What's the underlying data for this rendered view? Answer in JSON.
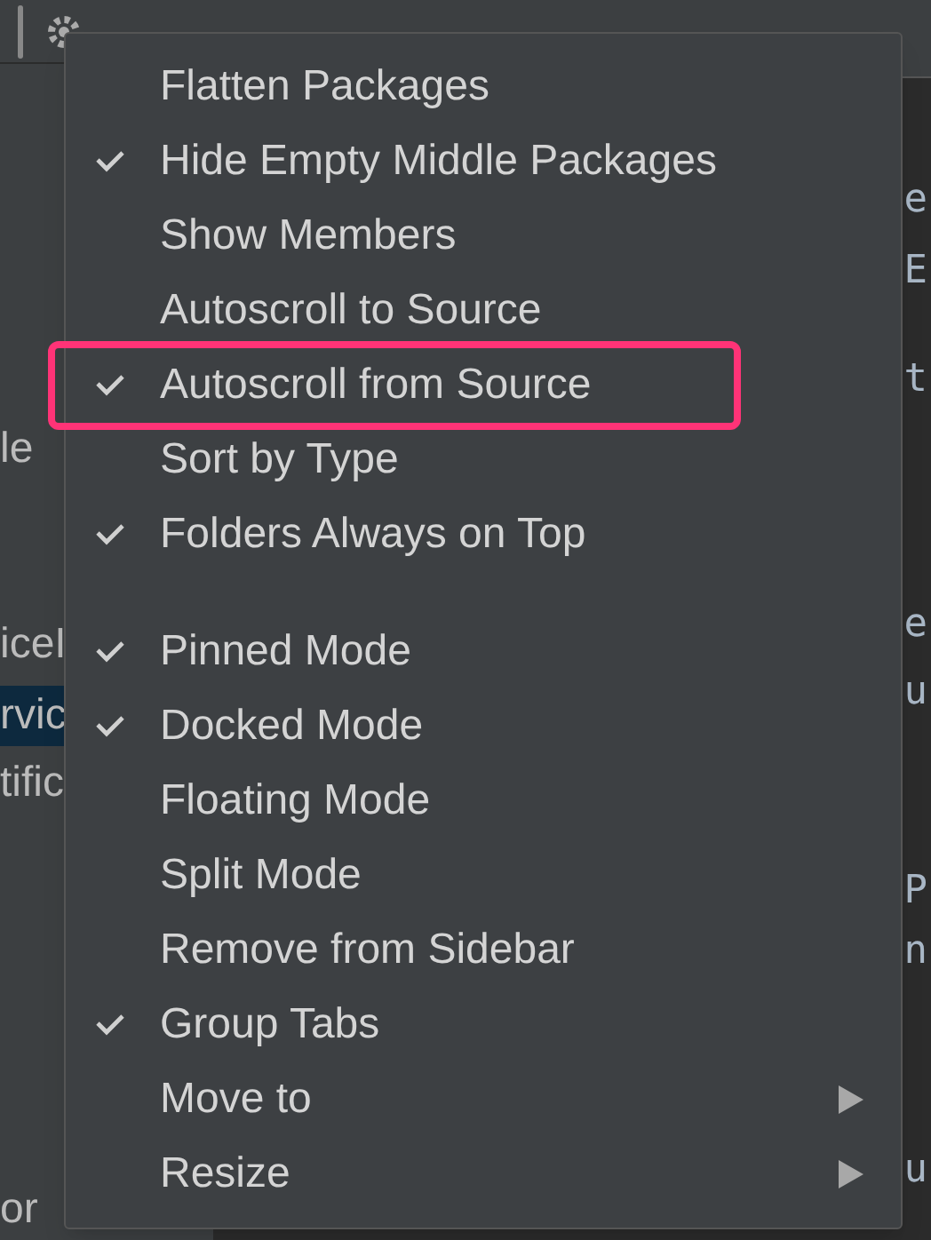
{
  "project_tree": [
    {
      "text": "le",
      "selected": false
    },
    {
      "text": "iceI",
      "selected": false
    },
    {
      "text": "rvic",
      "selected": true
    },
    {
      "text": "tific",
      "selected": false
    },
    {
      "text": "or",
      "selected": false
    }
  ],
  "editor_fragments": [
    "e",
    "E",
    "t",
    "e",
    "u",
    "P",
    "n",
    "u"
  ],
  "menu": {
    "groups": [
      [
        {
          "label": "Flatten Packages",
          "checked": false,
          "submenu": false,
          "highlighted": false
        },
        {
          "label": "Hide Empty Middle Packages",
          "checked": true,
          "submenu": false,
          "highlighted": false
        },
        {
          "label": "Show Members",
          "checked": false,
          "submenu": false,
          "highlighted": false
        },
        {
          "label": "Autoscroll to Source",
          "checked": false,
          "submenu": false,
          "highlighted": false
        },
        {
          "label": "Autoscroll from Source",
          "checked": true,
          "submenu": false,
          "highlighted": true
        },
        {
          "label": "Sort by Type",
          "checked": false,
          "submenu": false,
          "highlighted": false
        },
        {
          "label": "Folders Always on Top",
          "checked": true,
          "submenu": false,
          "highlighted": false
        }
      ],
      [
        {
          "label": "Pinned Mode",
          "checked": true,
          "submenu": false,
          "highlighted": false
        },
        {
          "label": "Docked Mode",
          "checked": true,
          "submenu": false,
          "highlighted": false
        },
        {
          "label": "Floating Mode",
          "checked": false,
          "submenu": false,
          "highlighted": false
        },
        {
          "label": "Split Mode",
          "checked": false,
          "submenu": false,
          "highlighted": false
        },
        {
          "label": "Remove from Sidebar",
          "checked": false,
          "submenu": false,
          "highlighted": false
        },
        {
          "label": "Group Tabs",
          "checked": true,
          "submenu": false,
          "highlighted": false
        },
        {
          "label": "Move to",
          "checked": false,
          "submenu": true,
          "highlighted": false
        },
        {
          "label": "Resize",
          "checked": false,
          "submenu": true,
          "highlighted": false
        }
      ]
    ]
  }
}
